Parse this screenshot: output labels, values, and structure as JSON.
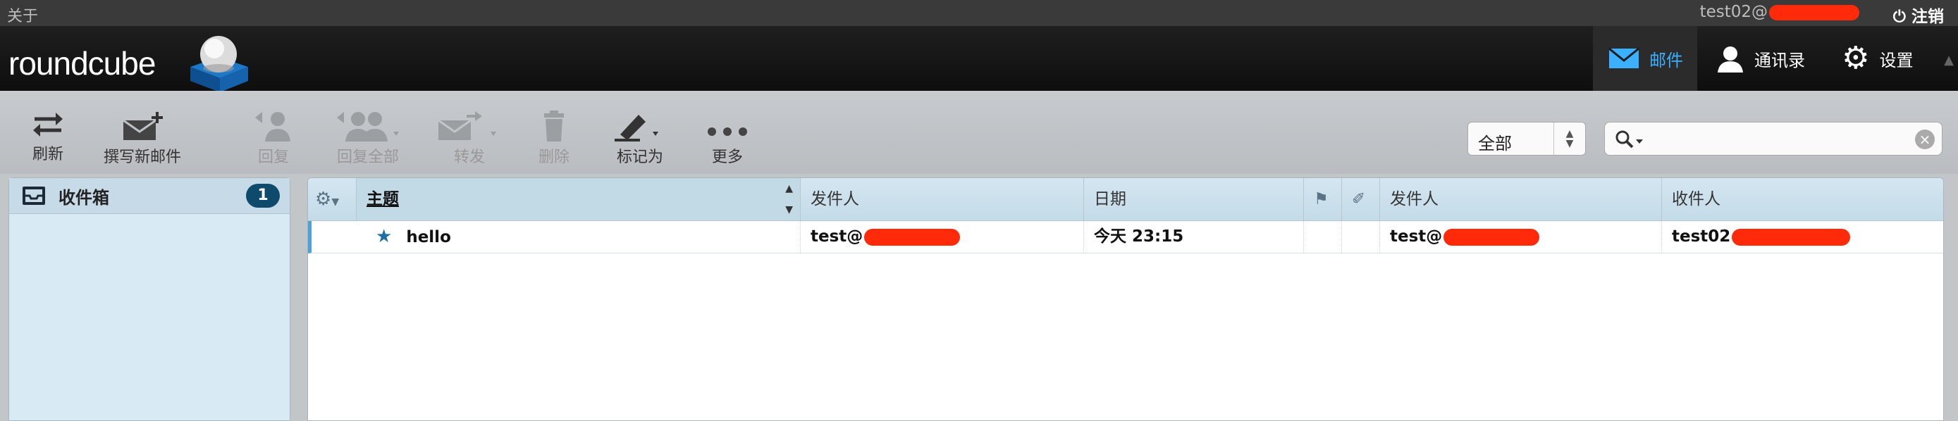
{
  "topbar": {
    "about": "关于",
    "user_email": "test02@",
    "logout": "注销"
  },
  "header": {
    "logo": "roundcube",
    "tasks": [
      {
        "label": "邮件",
        "icon": "mail-icon",
        "active": true
      },
      {
        "label": "通讯录",
        "icon": "contacts-icon"
      },
      {
        "label": "设置",
        "icon": "gear-icon"
      }
    ]
  },
  "toolbar": {
    "buttons": [
      {
        "label": "刷新",
        "icon": "refresh-icon",
        "enabled": true
      },
      {
        "label": "撰写新邮件",
        "icon": "compose-icon",
        "enabled": true
      },
      {
        "label": "回复",
        "icon": "reply-icon",
        "enabled": false
      },
      {
        "label": "回复全部",
        "icon": "reply-all-icon",
        "enabled": false
      },
      {
        "label": "转发",
        "icon": "forward-icon",
        "enabled": false
      },
      {
        "label": "删除",
        "icon": "delete-icon",
        "enabled": false
      },
      {
        "label": "标记为",
        "icon": "mark-icon",
        "enabled": true
      },
      {
        "label": "更多",
        "icon": "more-icon",
        "enabled": true
      }
    ],
    "filter": {
      "selected": "全部"
    },
    "search": {
      "value": "",
      "placeholder": ""
    }
  },
  "folders": [
    {
      "name": "收件箱",
      "unread": "1",
      "icon": "inbox-icon"
    }
  ],
  "message_list": {
    "columns": {
      "subject": "主题",
      "from": "发件人",
      "date": "日期",
      "from2": "发件人",
      "to": "收件人"
    },
    "rows": [
      {
        "subject": "hello",
        "from": "test@",
        "date": "今天 23:15",
        "from2": "test@",
        "to": "test02"
      }
    ]
  },
  "colors": {
    "accent": "#3ab0ff",
    "redaction": "#ff2a0a",
    "badge": "#0e4a6b"
  }
}
